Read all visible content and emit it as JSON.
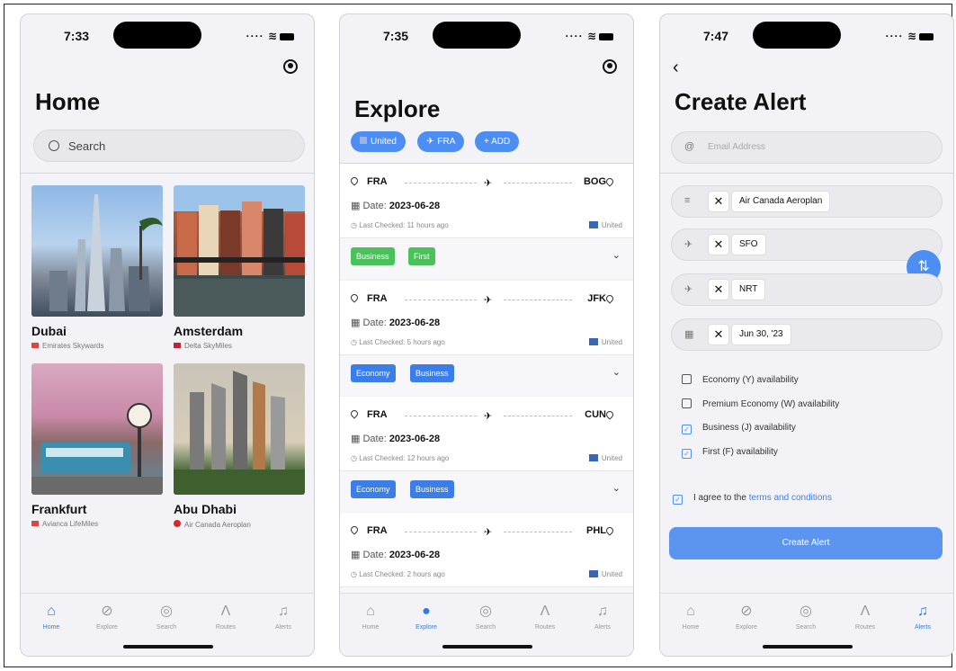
{
  "home": {
    "time": "7:33",
    "title": "Home",
    "search_placeholder": "Search",
    "cities": [
      {
        "name": "Dubai",
        "program": "Emirates Skywards"
      },
      {
        "name": "Amsterdam",
        "program": "Delta SkyMiles"
      },
      {
        "name": "Frankfurt",
        "program": "Avianca LifeMiles"
      },
      {
        "name": "Abu Dhabi",
        "program": "Air Canada Aeroplan"
      }
    ]
  },
  "explore": {
    "time": "7:35",
    "title": "Explore",
    "chips": [
      "United",
      "FRA",
      "+ ADD"
    ],
    "flights": [
      {
        "from": "FRA",
        "to": "BOG",
        "date_label": "Date:",
        "date": "2023-06-28",
        "last_checked": "Last Checked: 11 hours ago",
        "airline": "United",
        "fares": [
          "Business",
          "First"
        ]
      },
      {
        "from": "FRA",
        "to": "JFK",
        "date_label": "Date:",
        "date": "2023-06-28",
        "last_checked": "Last Checked: 5 hours ago",
        "airline": "United",
        "fares": [
          "Economy",
          "Business"
        ]
      },
      {
        "from": "FRA",
        "to": "CUN",
        "date_label": "Date:",
        "date": "2023-06-28",
        "last_checked": "Last Checked: 12 hours ago",
        "airline": "United",
        "fares": [
          "Economy",
          "Business"
        ]
      },
      {
        "from": "FRA",
        "to": "PHL",
        "date_label": "Date:",
        "date": "2023-06-28",
        "last_checked": "Last Checked: 2 hours ago",
        "airline": "United",
        "fares": []
      }
    ]
  },
  "alert": {
    "time": "7:47",
    "title": "Create Alert",
    "email_placeholder": "Email Address",
    "program": "Air Canada Aeroplan",
    "origin": "SFO",
    "destination": "NRT",
    "date": "Jun 30, '23",
    "options": [
      {
        "label": "Economy (Y) availability",
        "checked": false
      },
      {
        "label": "Premium Economy (W) availability",
        "checked": false
      },
      {
        "label": "Business (J) availability",
        "checked": true
      },
      {
        "label": "First (F) availability",
        "checked": true
      }
    ],
    "agree_prefix": "I agree to the",
    "agree_link": "terms and conditions",
    "create_button": "Create Alert"
  },
  "tabs": [
    "Home",
    "Explore",
    "Search",
    "Routes",
    "Alerts"
  ],
  "colors": {
    "accent": "#4c8ef2",
    "green_tag": "#4cc05a",
    "blue_tag": "#3c7ee8"
  },
  "icons": {
    "tabs": [
      "house-icon",
      "compass-icon",
      "search-icon",
      "routes-icon",
      "bell-icon"
    ]
  }
}
